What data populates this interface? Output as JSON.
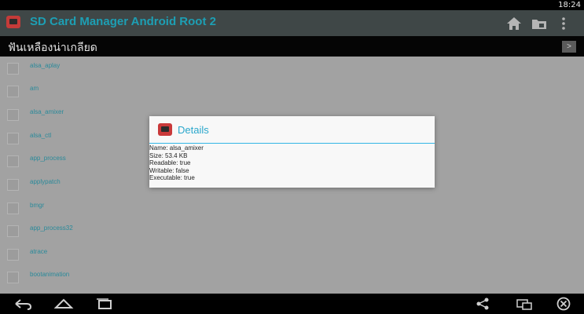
{
  "status_bar": {
    "time": "18:24"
  },
  "action_bar": {
    "title": "SD Card Manager Android Root 2",
    "icons": [
      "app-icon",
      "home-icon",
      "folder-icon",
      "overflow-menu-icon"
    ]
  },
  "path_bar": {
    "label": "ฟันเหลืองน่าเกลียด",
    "arrow": ">"
  },
  "file_list": {
    "rows": [
      {
        "label": "alsa_aplay"
      },
      {
        "label": "am"
      },
      {
        "label": "alsa_amixer"
      },
      {
        "label": "alsa_ctl"
      },
      {
        "label": "app_process"
      },
      {
        "label": "applypatch"
      },
      {
        "label": "bmgr"
      },
      {
        "label": "app_process32"
      },
      {
        "label": "atrace"
      },
      {
        "label": "bootanimation"
      }
    ]
  },
  "dialog": {
    "title": "Details",
    "lines": [
      "Name: alsa_amixer",
      "Size: 53.4 KB",
      "Readable: true",
      "Writable: false",
      "Executable: true"
    ]
  },
  "nav_bar": {
    "icons": [
      "back-icon",
      "home-icon",
      "recent-apps-icon",
      "share-icon",
      "screen-icon",
      "close-icon"
    ]
  }
}
